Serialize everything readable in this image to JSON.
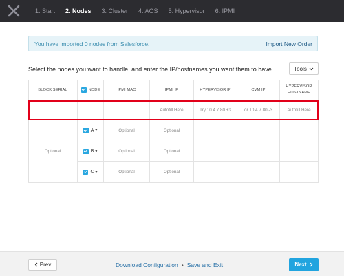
{
  "steps": [
    {
      "label": "1. Start",
      "active": false
    },
    {
      "label": "2. Nodes",
      "active": true
    },
    {
      "label": "3. Cluster",
      "active": false
    },
    {
      "label": "4. AOS",
      "active": false
    },
    {
      "label": "5. Hypervisor",
      "active": false
    },
    {
      "label": "6. IPMI",
      "active": false
    }
  ],
  "banner": {
    "message": "You have imported 0 nodes from Salesforce.",
    "link": "Import New Order"
  },
  "instructions": "Select the nodes you want to handle, and enter the IP/hostnames you want them to have.",
  "tools": {
    "label": "Tools",
    "icon": "chevron-down-icon"
  },
  "table": {
    "headers": {
      "block_serial": "BLOCK SERIAL",
      "node": "NODE",
      "ipmi_mac": "IPMI MAC",
      "ipmi_ip": "IPMI IP",
      "hypervisor_ip": "HYPERVISOR IP",
      "cvm_ip": "CVM IP",
      "hypervisor_hostname_1": "HYPERVISOR",
      "hypervisor_hostname_2": "HOSTNAME"
    },
    "autofill_row": {
      "ipmi_ip": "Autofill Here",
      "hypervisor_ip": "Try 10.4.7.80 +3",
      "cvm_ip": "or 10.4.7.80 -3",
      "hostname": "Autofill Here"
    },
    "block_serial_placeholder": "Optional",
    "nodes": [
      {
        "letter": "A",
        "checked": true,
        "ipmi_mac": "Optional",
        "ipmi_ip": "Optional"
      },
      {
        "letter": "B",
        "checked": true,
        "ipmi_mac": "Optional",
        "ipmi_ip": "Optional"
      },
      {
        "letter": "C",
        "checked": true,
        "ipmi_mac": "Optional",
        "ipmi_ip": "Optional"
      }
    ]
  },
  "footer": {
    "prev": "Prev",
    "download": "Download Configuration",
    "separator": "•",
    "save": "Save and Exit",
    "next": "Next"
  },
  "colors": {
    "topbar": "#2c2c30",
    "accent": "#21a4df",
    "highlight": "#e2001a",
    "banner_bg": "#e6f3f8",
    "link": "#2a72a8"
  }
}
